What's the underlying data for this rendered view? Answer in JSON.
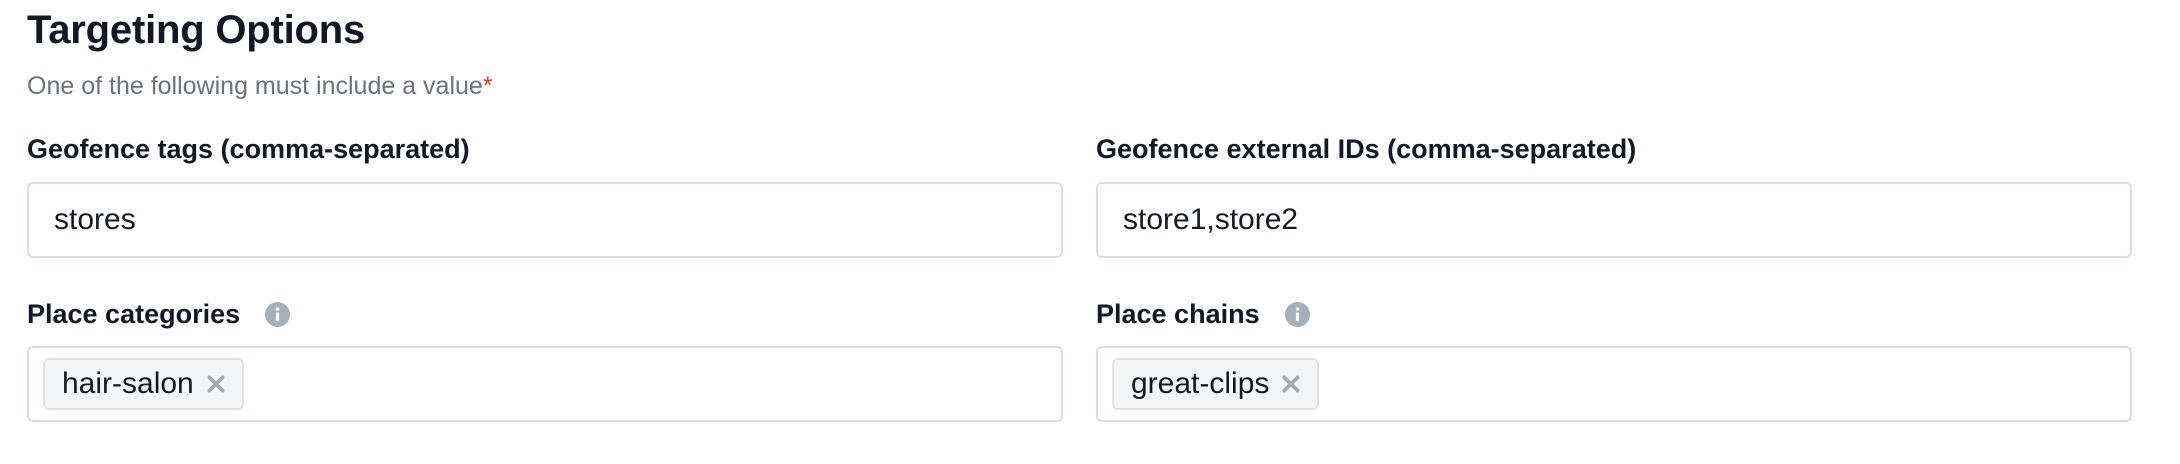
{
  "section": {
    "title": "Targeting Options",
    "subtitle": "One of the following must include a value",
    "required_marker": "*"
  },
  "fields": {
    "geofence_tags": {
      "label": "Geofence tags (comma-separated)",
      "value": "stores"
    },
    "geofence_external_ids": {
      "label": "Geofence external IDs (comma-separated)",
      "value": "store1,store2"
    },
    "place_categories": {
      "label": "Place categories",
      "info_icon": "info-icon",
      "tags": [
        "hair-salon"
      ]
    },
    "place_chains": {
      "label": "Place chains",
      "info_icon": "info-icon",
      "tags": [
        "great-clips"
      ]
    }
  },
  "colors": {
    "required": "#d33d2c",
    "info_icon": "#a5b0bd",
    "chip_bg": "#f3f5f7",
    "border": "#d9dee4"
  }
}
